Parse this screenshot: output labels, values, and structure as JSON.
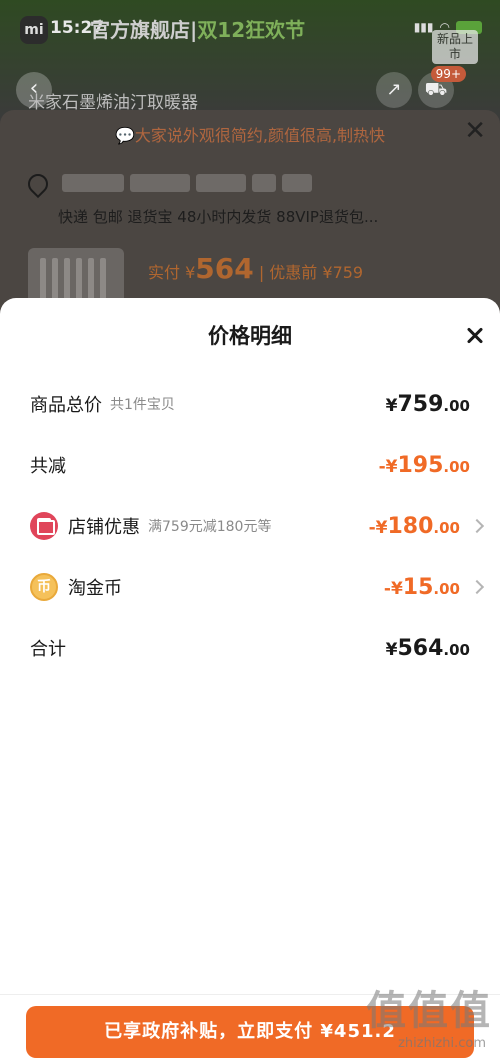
{
  "status_bar": {
    "time": "15:27",
    "store_name": "官方旗舰店",
    "event_text": "双12狂欢节",
    "new_badge": "新品上市"
  },
  "background": {
    "product_title": "米家石墨烯油汀取暖器",
    "cart_count": "99+",
    "review_hint": "大家说外观很简约,颜值很高,制热快",
    "services": "快递 包邮 退货宝 48小时内发货 88VIP退货包...",
    "price_prefix": "实付 ¥",
    "price_value": "564",
    "price_before": "| 优惠前 ¥759"
  },
  "sheet": {
    "title": "价格明细",
    "rows": [
      {
        "label": "商品总价",
        "sub": "共1件宝贝",
        "currency": "¥",
        "int": "759",
        "dec": ".00"
      },
      {
        "label": "共减",
        "sub": "",
        "currency": "-¥",
        "int": "195",
        "dec": ".00"
      },
      {
        "label": "店铺优惠",
        "sub": "满759元减180元等",
        "currency": "-¥",
        "int": "180",
        "dec": ".00"
      },
      {
        "label": "淘金币",
        "sub": "",
        "currency": "-¥",
        "int": "15",
        "dec": ".00"
      },
      {
        "label": "合计",
        "sub": "",
        "currency": "¥",
        "int": "564",
        "dec": ".00"
      }
    ],
    "pay_button": "已享政府补贴，立即支付 ¥451.2"
  },
  "icons": {
    "coin_glyph": "币"
  },
  "watermark": {
    "logo": "值值值",
    "url": "zhizhizhi.com"
  },
  "colors": {
    "accent": "#f06a26",
    "shop_icon": "#e0455a",
    "coin_icon": "#f5c15a"
  }
}
